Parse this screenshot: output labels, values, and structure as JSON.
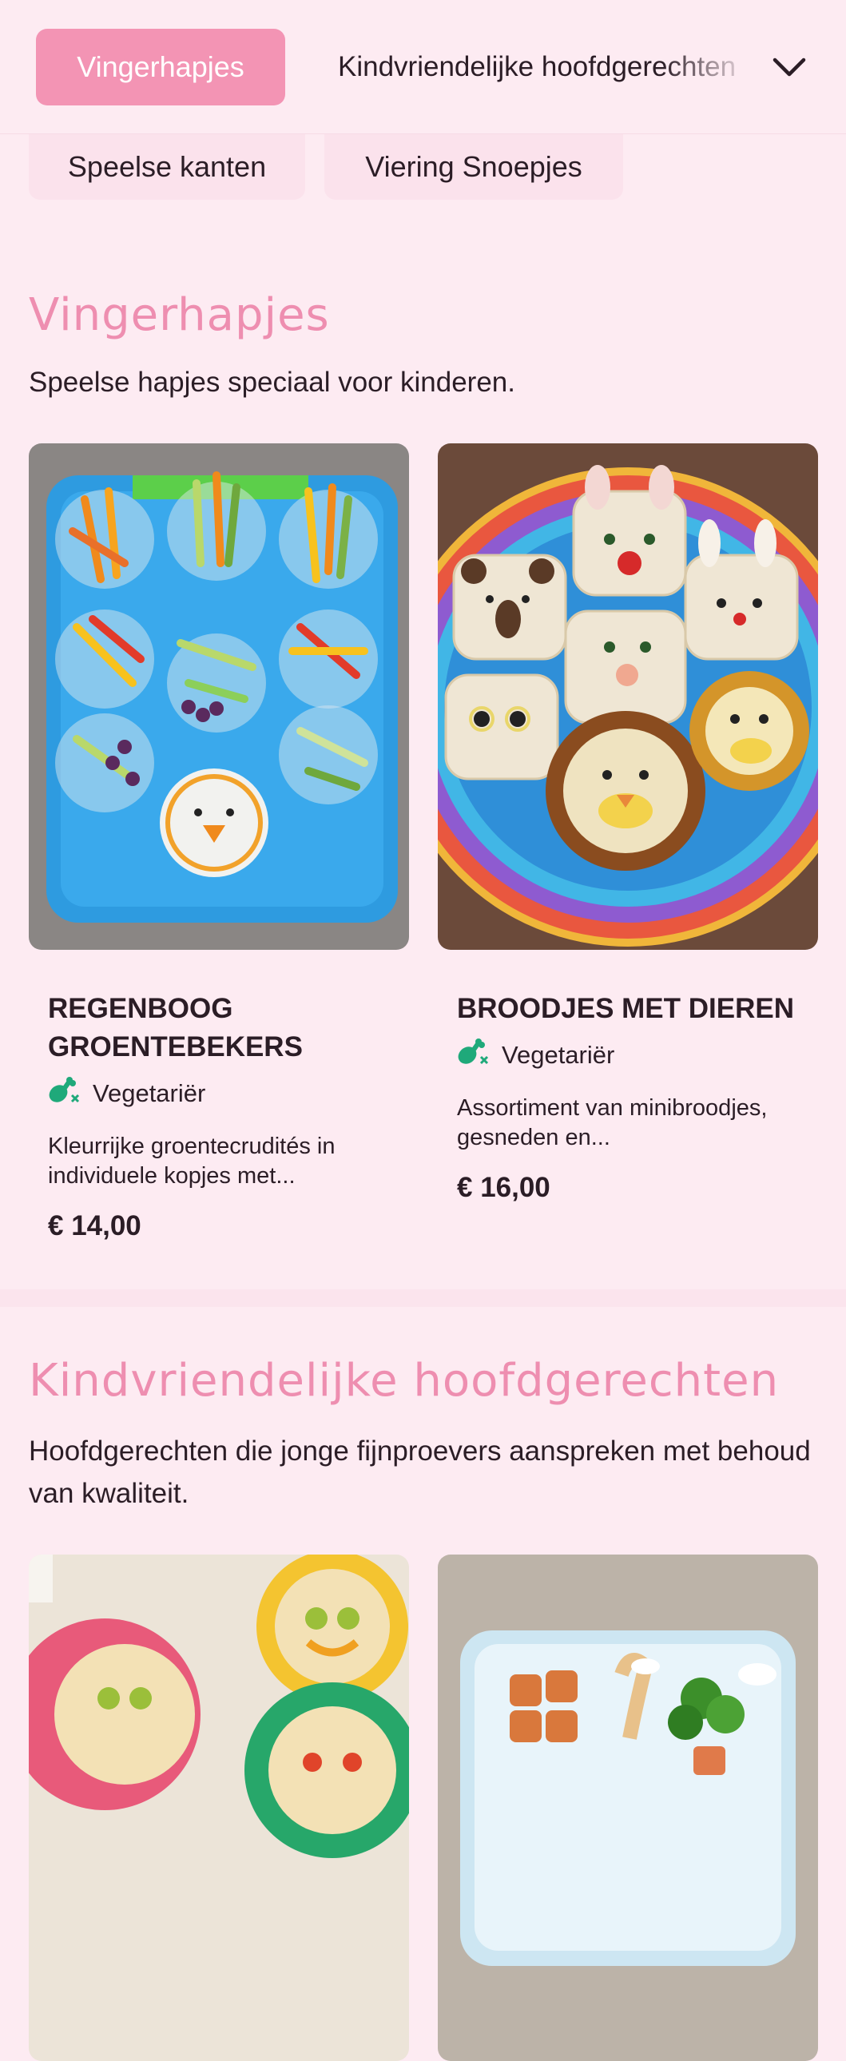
{
  "categories": {
    "active": "Vingerhapjes",
    "next": "Kindvriendelijke hoofdgerechten",
    "row2": [
      "Speelse kanten",
      "Viering Snoepjes"
    ],
    "expand_icon": "chevron-down-icon"
  },
  "sections": [
    {
      "title": "Vingerhapjes",
      "description": "Speelse hapjes speciaal voor kinderen.",
      "items": [
        {
          "name": "REGENBOOG GROENTEBEKERS",
          "diet": "Vegetariër",
          "diet_icon": "drumstick-crossed-icon",
          "description": "Kleurrijke groentecrudités in individuele kopjes met...",
          "price": "€ 14,00"
        },
        {
          "name": "BROODJES MET DIEREN",
          "diet": "Vegetariër",
          "diet_icon": "drumstick-crossed-icon",
          "description": "Assortiment van minibroodjes, gesneden en...",
          "price": "€ 16,00"
        }
      ]
    },
    {
      "title": "Kindvriendelijke hoofdgerechten",
      "description": "Hoofdgerechten die jonge fijnproevers aanspreken met behoud van kwaliteit."
    }
  ],
  "colors": {
    "background": "#fdebf2",
    "accent_pink": "#f394b4",
    "title_pink": "#ee8eb0",
    "vegetarian_green": "#1fa97a",
    "text": "#2b1d26"
  }
}
